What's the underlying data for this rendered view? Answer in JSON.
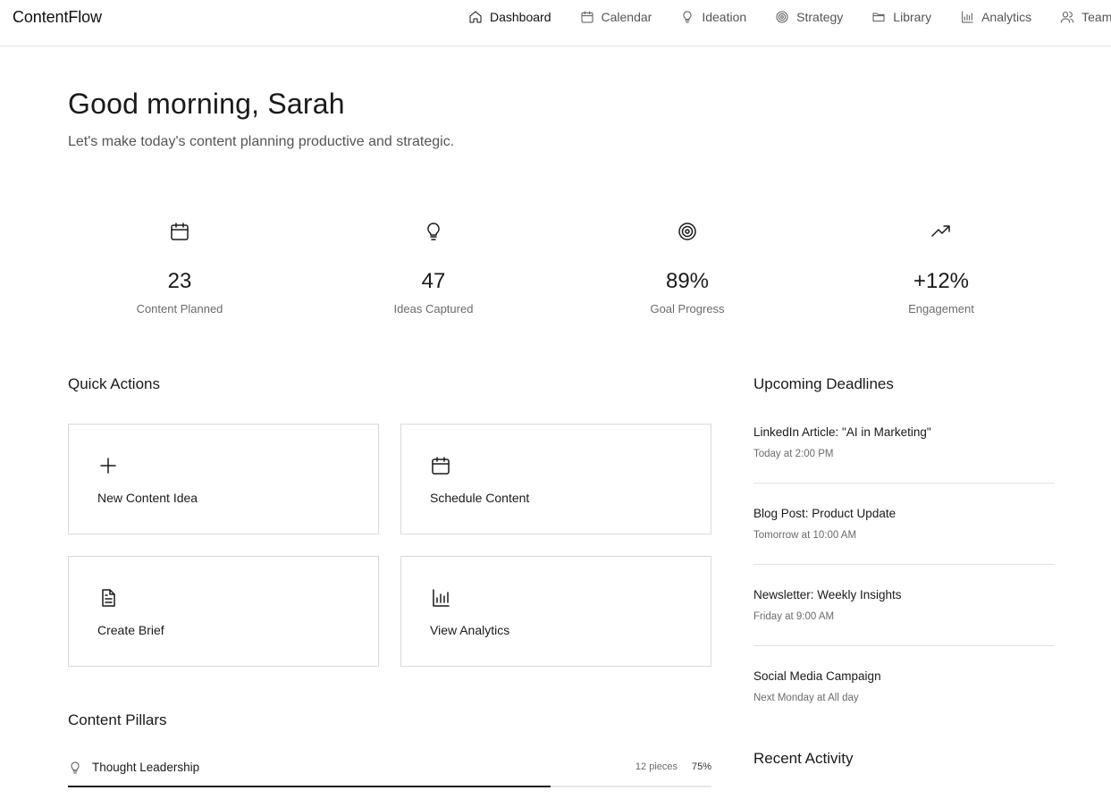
{
  "app": {
    "brand": "ContentFlow"
  },
  "nav": {
    "items": [
      {
        "label": "Dashboard",
        "icon": "home-icon",
        "active": true
      },
      {
        "label": "Calendar",
        "icon": "calendar-icon",
        "active": false
      },
      {
        "label": "Ideation",
        "icon": "lightbulb-icon",
        "active": false
      },
      {
        "label": "Strategy",
        "icon": "target-icon",
        "active": false
      },
      {
        "label": "Library",
        "icon": "folder-icon",
        "active": false
      },
      {
        "label": "Analytics",
        "icon": "bar-chart-icon",
        "active": false
      },
      {
        "label": "Team",
        "icon": "users-icon",
        "active": false
      }
    ]
  },
  "hero": {
    "greeting": "Good morning, Sarah",
    "subtitle": "Let's make today's content planning productive and strategic."
  },
  "stats": [
    {
      "icon": "calendar-icon",
      "value": "23",
      "label": "Content Planned"
    },
    {
      "icon": "lightbulb-icon",
      "value": "47",
      "label": "Ideas Captured"
    },
    {
      "icon": "target-icon",
      "value": "89%",
      "label": "Goal Progress"
    },
    {
      "icon": "trending-up-icon",
      "value": "+12%",
      "label": "Engagement"
    }
  ],
  "quick_actions": {
    "title": "Quick Actions",
    "items": [
      {
        "icon": "plus-icon",
        "label": "New Content Idea"
      },
      {
        "icon": "calendar-icon",
        "label": "Schedule Content"
      },
      {
        "icon": "document-icon",
        "label": "Create Brief"
      },
      {
        "icon": "bar-chart-icon",
        "label": "View Analytics"
      }
    ]
  },
  "deadlines": {
    "title": "Upcoming Deadlines",
    "items": [
      {
        "title": "LinkedIn Article: \"AI in Marketing\"",
        "when": "Today at 2:00 PM"
      },
      {
        "title": "Blog Post: Product Update",
        "when": "Tomorrow at 10:00 AM"
      },
      {
        "title": "Newsletter: Weekly Insights",
        "when": "Friday at 9:00 AM"
      },
      {
        "title": "Social Media Campaign",
        "when": "Next Monday at All day"
      }
    ]
  },
  "recent_activity": {
    "title": "Recent Activity"
  },
  "pillars": {
    "title": "Content Pillars",
    "items": [
      {
        "icon": "lightbulb-icon",
        "name": "Thought Leadership",
        "count": "12 pieces",
        "percent": "75%",
        "progress": 0.75
      }
    ]
  },
  "colors": {
    "text": "#1a1a1a",
    "muted": "#6b6b6b",
    "border": "#d9d9d9",
    "progress": "#1a1a1a"
  }
}
